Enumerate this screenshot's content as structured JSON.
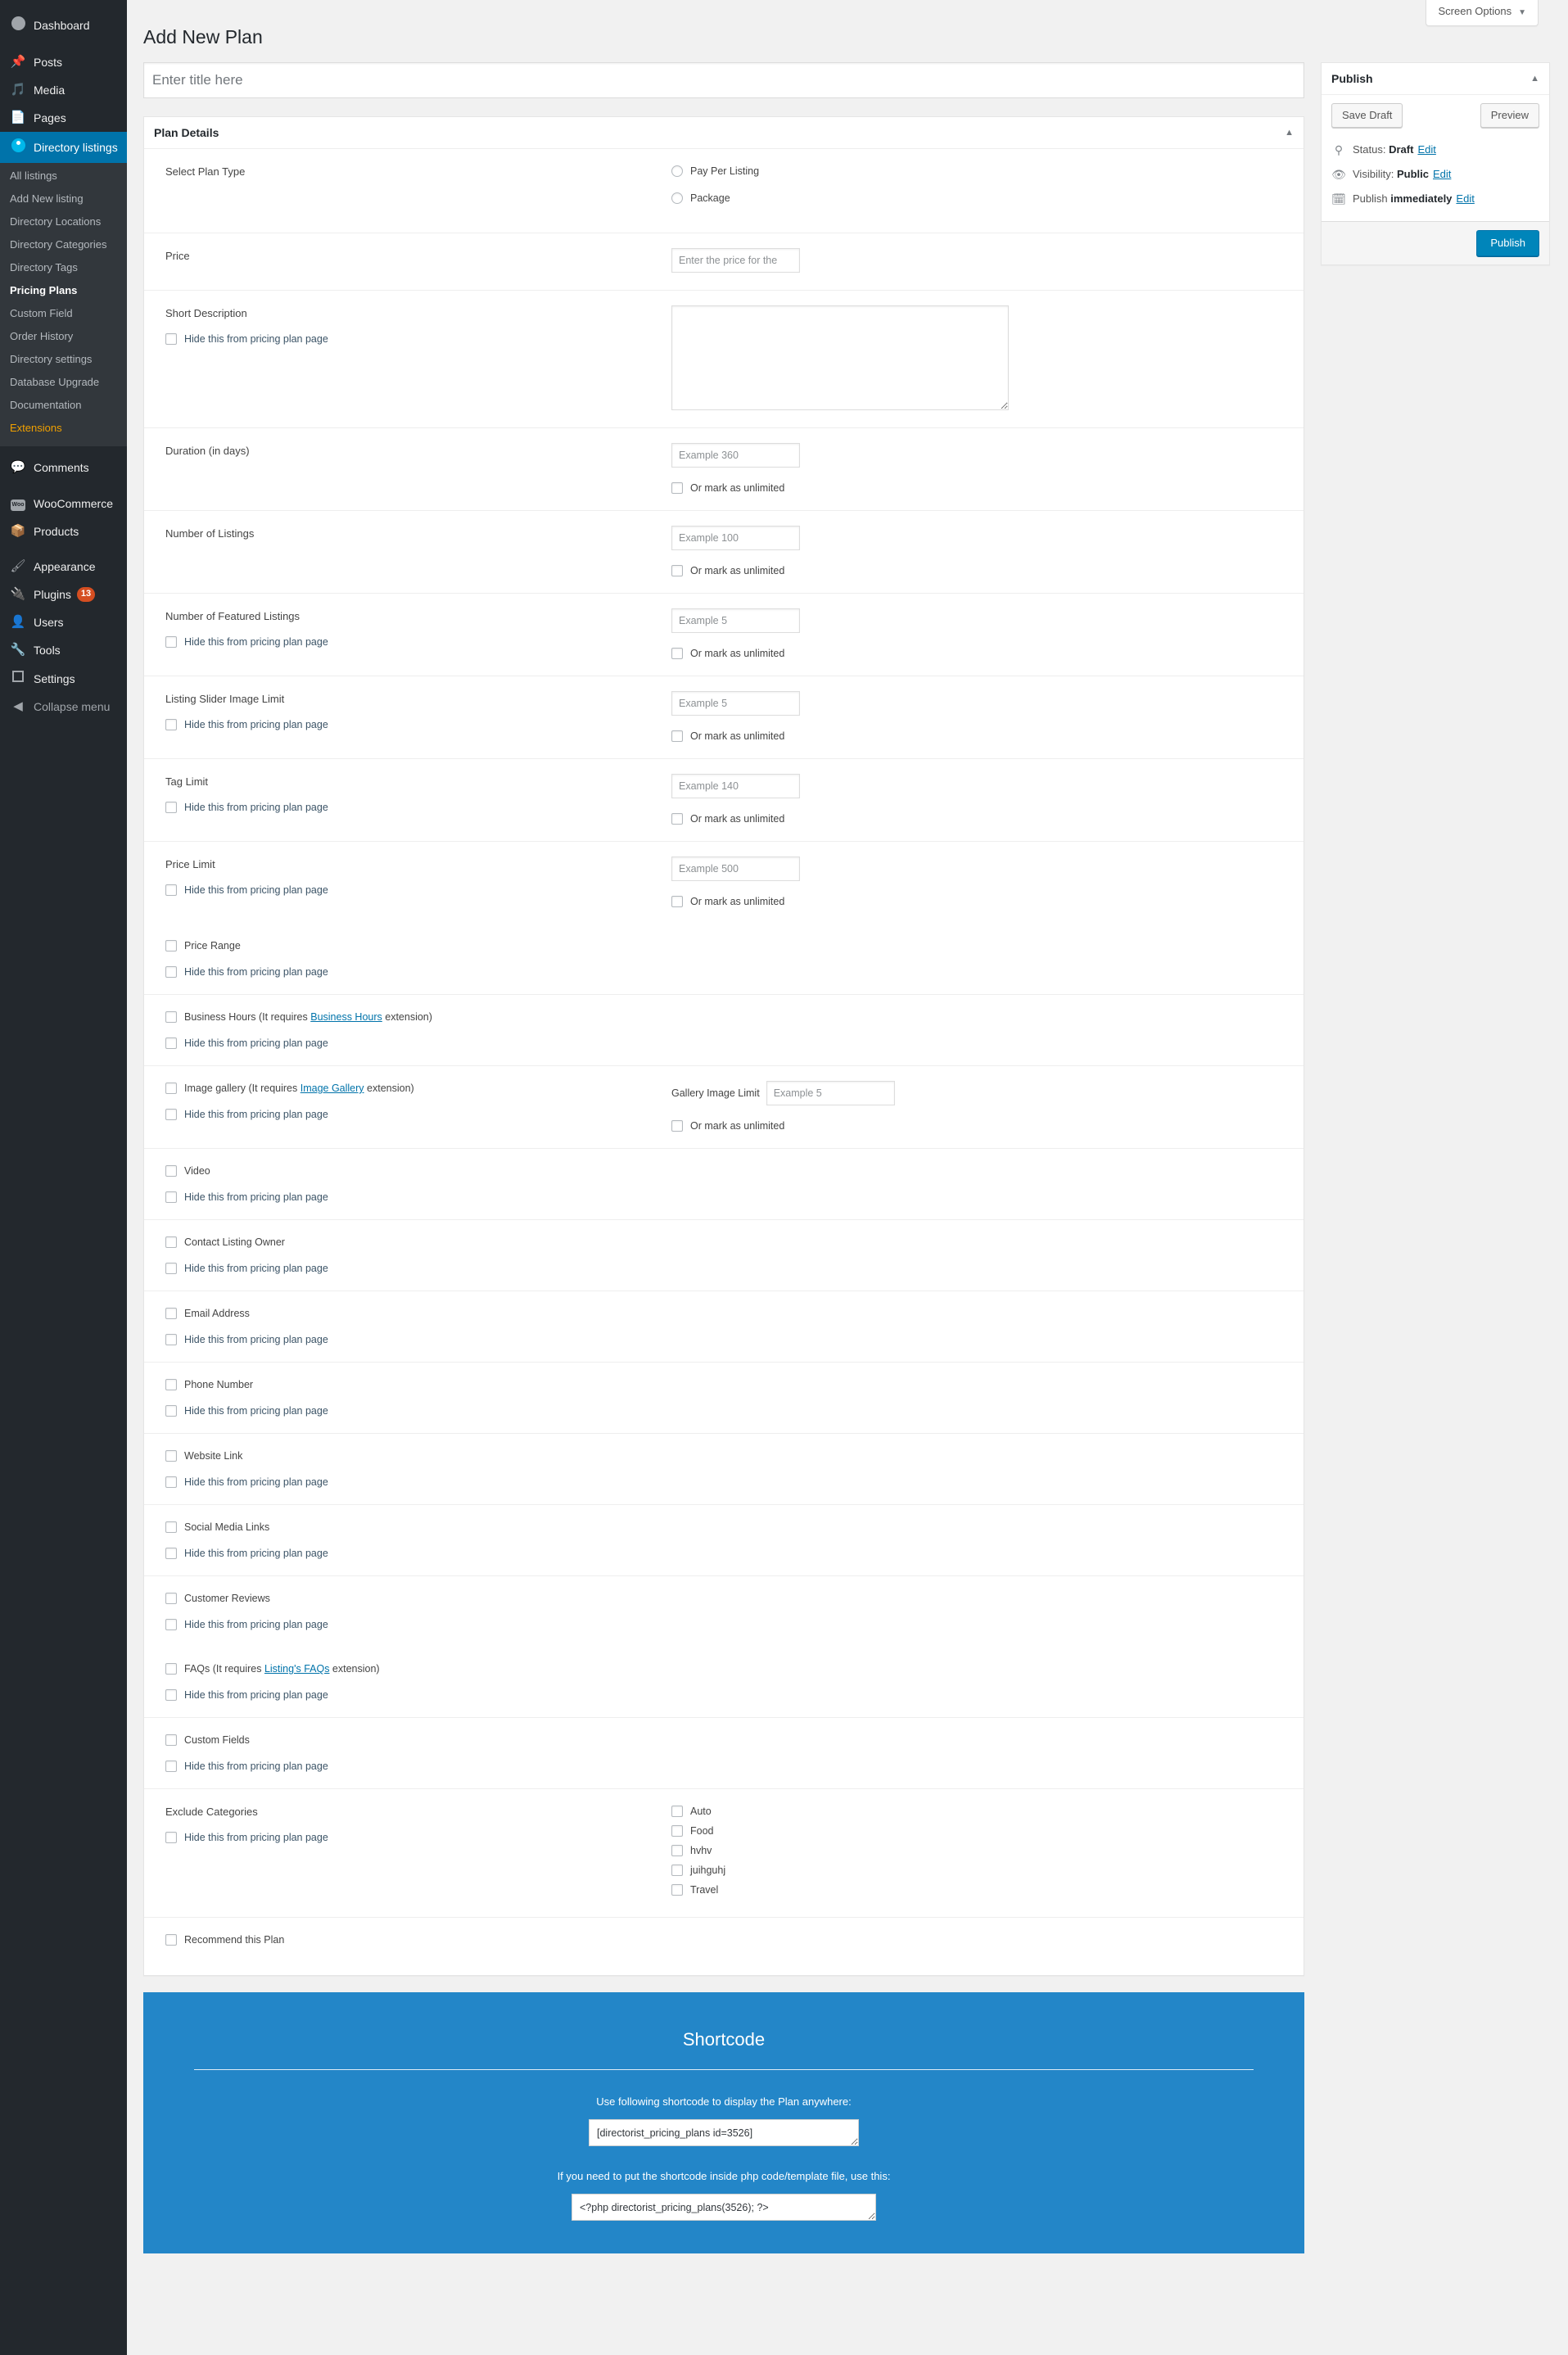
{
  "sidebar": {
    "items": [
      {
        "label": "Dashboard",
        "icon": "dashboard-icon",
        "name": "dashboard"
      },
      {
        "label": "Posts",
        "icon": "pin-icon",
        "name": "posts"
      },
      {
        "label": "Media",
        "icon": "media-icon",
        "name": "media"
      },
      {
        "label": "Pages",
        "icon": "pages-icon",
        "name": "pages"
      },
      {
        "label": "Directory listings",
        "icon": "map-pin-icon",
        "name": "directory-listings",
        "current": true
      }
    ],
    "submenu": [
      {
        "label": "All listings",
        "name": "all-listings"
      },
      {
        "label": "Add New listing",
        "name": "add-new-listing"
      },
      {
        "label": "Directory Locations",
        "name": "directory-locations"
      },
      {
        "label": "Directory Categories",
        "name": "directory-categories"
      },
      {
        "label": "Directory Tags",
        "name": "directory-tags"
      },
      {
        "label": "Pricing Plans",
        "name": "pricing-plans",
        "current": true
      },
      {
        "label": "Custom Field",
        "name": "custom-field"
      },
      {
        "label": "Order History",
        "name": "order-history"
      },
      {
        "label": "Directory settings",
        "name": "directory-settings"
      },
      {
        "label": "Database Upgrade",
        "name": "database-upgrade"
      },
      {
        "label": "Documentation",
        "name": "documentation"
      },
      {
        "label": "Extensions",
        "name": "extensions",
        "highlight": true
      }
    ],
    "items2": [
      {
        "label": "Comments",
        "icon": "comments-icon",
        "name": "comments"
      },
      {
        "label": "WooCommerce",
        "icon": "woocommerce-icon",
        "name": "woocommerce"
      },
      {
        "label": "Products",
        "icon": "products-icon",
        "name": "products"
      }
    ],
    "items3": [
      {
        "label": "Appearance",
        "icon": "appearance-icon",
        "name": "appearance"
      },
      {
        "label": "Plugins",
        "icon": "plugins-icon",
        "name": "plugins",
        "badge": "13"
      },
      {
        "label": "Users",
        "icon": "users-icon",
        "name": "users"
      },
      {
        "label": "Tools",
        "icon": "tools-icon",
        "name": "tools"
      },
      {
        "label": "Settings",
        "icon": "settings-icon",
        "name": "settings"
      }
    ],
    "collapse": {
      "label": "Collapse menu",
      "icon": "collapse-icon"
    }
  },
  "screen_options": {
    "label": "Screen Options",
    "caret": "▼"
  },
  "page": {
    "title": "Add New Plan",
    "title_placeholder": "Enter title here",
    "title_value": ""
  },
  "plan_details": {
    "heading": "Plan Details",
    "toggle_icon": "▲",
    "hide_label": "Hide this from pricing plan page",
    "unlimited_label": "Or mark as unlimited",
    "plan_type": {
      "label": "Select Plan Type",
      "options": [
        {
          "label": "Pay Per Listing",
          "name": "pay-per-listing"
        },
        {
          "label": "Package",
          "name": "package"
        }
      ]
    },
    "price": {
      "label": "Price",
      "placeholder": "Enter the price for the",
      "value": ""
    },
    "short_description": {
      "label": "Short Description",
      "value": ""
    },
    "numeric_rows": [
      {
        "label": "Duration (in days)",
        "placeholder": "Example 360",
        "name": "duration",
        "hide": false,
        "unlimited": true
      },
      {
        "label": "Number of Listings",
        "placeholder": "Example 100",
        "name": "number-of-listings",
        "hide": false,
        "unlimited": true
      },
      {
        "label": "Number of Featured Listings",
        "placeholder": "Example 5",
        "name": "number-of-featured-listings",
        "hide": true,
        "unlimited": true
      },
      {
        "label": "Listing Slider Image Limit",
        "placeholder": "Example 5",
        "name": "listing-slider-image-limit",
        "hide": true,
        "unlimited": true
      },
      {
        "label": "Tag Limit",
        "placeholder": "Example 140",
        "name": "tag-limit",
        "hide": true,
        "unlimited": true
      },
      {
        "label": "Price Limit",
        "placeholder": "Example 500",
        "name": "price-limit",
        "hide": true,
        "unlimited": true
      }
    ],
    "price_range": {
      "label": "Price Range",
      "name": "price-range"
    },
    "business_hours": {
      "pre": "Business Hours (It requires ",
      "link": "Business Hours",
      "post": " extension)",
      "name": "business-hours"
    },
    "image_gallery": {
      "pre": "Image gallery (It requires ",
      "link": "Image Gallery",
      "post": " extension)",
      "name": "image-gallery",
      "limit_label": "Gallery Image Limit",
      "limit_placeholder": "Example 5"
    },
    "simple_rows": [
      {
        "label": "Video",
        "name": "video"
      },
      {
        "label": "Contact Listing Owner",
        "name": "contact-listing-owner"
      },
      {
        "label": "Email Address",
        "name": "email-address"
      },
      {
        "label": "Phone Number",
        "name": "phone-number"
      },
      {
        "label": "Website Link",
        "name": "website-link"
      },
      {
        "label": "Social Media Links",
        "name": "social-media-links"
      },
      {
        "label": "Customer Reviews",
        "name": "customer-reviews"
      }
    ],
    "faqs": {
      "pre": "FAQs (It requires ",
      "link": "Listing's FAQs",
      "post": " extension)",
      "name": "faqs"
    },
    "custom_fields": {
      "label": "Custom Fields",
      "name": "custom-fields"
    },
    "exclude_categories": {
      "label": "Exclude Categories",
      "items": [
        "Auto",
        "Food",
        "hvhv",
        "juihguhj",
        "Travel"
      ]
    },
    "recommend": {
      "label": "Recommend this Plan",
      "name": "recommend-this-plan"
    }
  },
  "shortcode": {
    "title": "Shortcode",
    "label_1": "Use following shortcode to display the Plan anywhere:",
    "value_1": "[directorist_pricing_plans id=3526]",
    "label_2": "If you need to put the shortcode inside php code/template file, use this:",
    "value_2": "<?php directorist_pricing_plans(3526); ?>"
  },
  "publish": {
    "heading": "Publish",
    "toggle_icon": "▲",
    "save_draft": "Save Draft",
    "preview": "Preview",
    "status_label": "Status:",
    "status_value": "Draft",
    "status_edit": "Edit",
    "visibility_label": "Visibility:",
    "visibility_value": "Public",
    "visibility_edit": "Edit",
    "schedule_label": "Publish",
    "schedule_value": "immediately",
    "schedule_edit": "Edit",
    "publish_button": "Publish"
  },
  "colors": {
    "accent": "#0073aa",
    "publish_button": "#0085ba",
    "shortcode_bg": "#2386c8",
    "sidebar_bg": "#23282d",
    "submenu_bg": "#32373c",
    "extension_highlight": "#f0a000",
    "badge": "#d54e21"
  }
}
